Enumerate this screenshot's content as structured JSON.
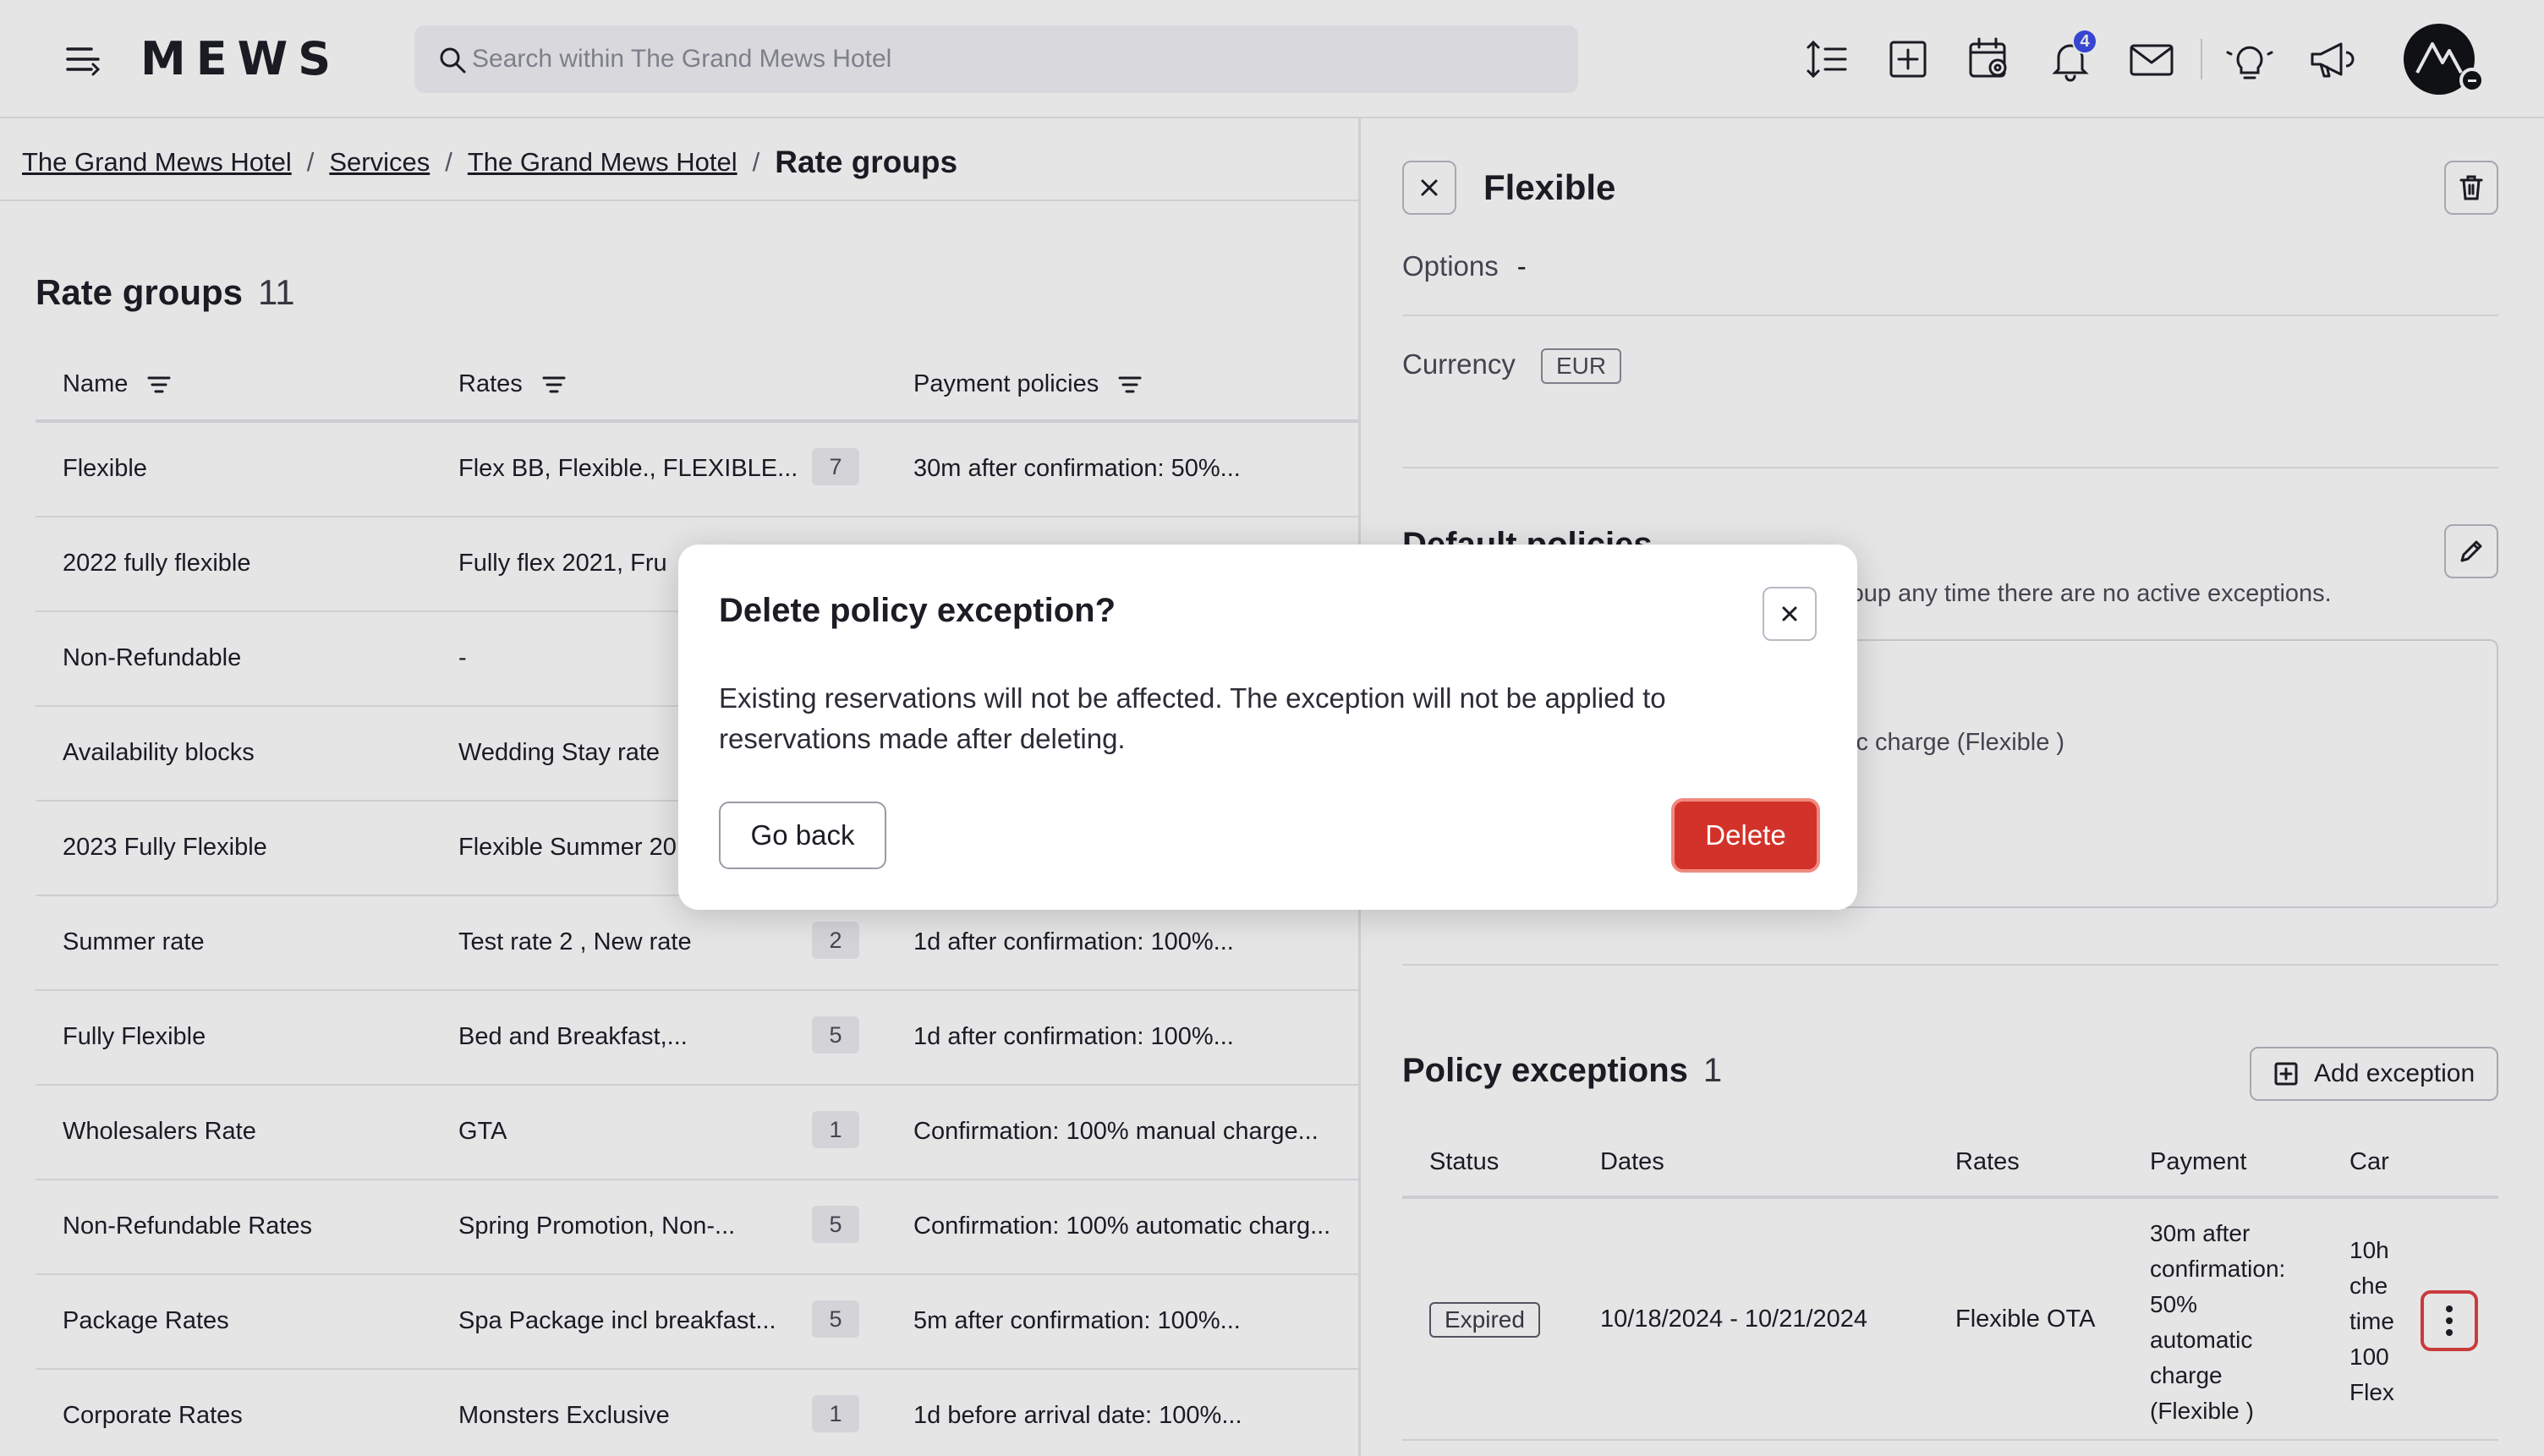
{
  "header": {
    "logo": "MEWS",
    "search_placeholder": "Search within The Grand Mews Hotel",
    "notification_count": "4",
    "icons": [
      "menu-icon",
      "sort-icon",
      "add-square-icon",
      "calendar-icon",
      "bell-icon",
      "mail-icon",
      "bulb-icon",
      "megaphone-icon",
      "avatar"
    ]
  },
  "breadcrumb": {
    "items": [
      "The Grand Mews Hotel",
      "Services",
      "The Grand Mews Hotel"
    ],
    "current": "Rate groups",
    "separator": "/"
  },
  "rate_groups": {
    "title": "Rate groups",
    "count": "11",
    "columns": [
      "Name",
      "Rates",
      "Payment policies"
    ],
    "rows": [
      {
        "name": "Flexible",
        "rates": "Flex BB, Flexible., FLEXIBLE...",
        "count": "7",
        "payment": "30m after confirmation: 50%..."
      },
      {
        "name": "2022 fully flexible",
        "rates": "Fully flex 2021, Fru",
        "count": "",
        "payment": ""
      },
      {
        "name": "Non-Refundable",
        "rates": "-",
        "count": "",
        "payment": ""
      },
      {
        "name": "Availability blocks",
        "rates": "Wedding Stay rate",
        "count": "",
        "payment": ""
      },
      {
        "name": "2023 Fully Flexible",
        "rates": "Flexible Summer 20",
        "count": "",
        "payment": ""
      },
      {
        "name": "Summer rate",
        "rates": "Test rate 2 , New rate",
        "count": "2",
        "payment": "1d after confirmation: 100%..."
      },
      {
        "name": "Fully Flexible",
        "rates": "Bed and Breakfast,...",
        "count": "5",
        "payment": "1d after confirmation: 100%..."
      },
      {
        "name": "Wholesalers Rate",
        "rates": "GTA",
        "count": "1",
        "payment": "Confirmation: 100% manual charge..."
      },
      {
        "name": "Non-Refundable Rates",
        "rates": "Spring Promotion, Non-...",
        "count": "5",
        "payment": "Confirmation: 100% automatic charg..."
      },
      {
        "name": "Package Rates",
        "rates": "Spa Package incl breakfast...",
        "count": "5",
        "payment": "5m after confirmation: 100%..."
      },
      {
        "name": "Corporate Rates",
        "rates": "Monsters Exclusive",
        "count": "1",
        "payment": "1d before arrival date: 100%..."
      }
    ]
  },
  "detail": {
    "title": "Flexible",
    "options_label": "Options",
    "options_value": "-",
    "currency_label": "Currency",
    "currency_value": "EUR",
    "default_policies_title": "Default policies",
    "default_policies_desc": "roup any time there are no active exceptions.",
    "default_policy_text": "tic charge (Flexible )",
    "exceptions_title": "Policy exceptions",
    "exceptions_count": "1",
    "add_exception_label": "Add exception",
    "exception_columns": [
      "Status",
      "Dates",
      "Rates",
      "Payment",
      "Car"
    ],
    "exception": {
      "status": "Expired",
      "dates": "10/18/2024 - 10/21/2024",
      "rates": "Flexible OTA",
      "payment_lines": [
        "30m after",
        "confirmation:",
        "50%",
        "automatic",
        "charge",
        "(Flexible )"
      ],
      "cancel_lines": [
        "10h",
        "che",
        "time",
        "100",
        "Flex"
      ]
    }
  },
  "modal": {
    "title": "Delete policy exception?",
    "body": "Existing reservations will not be affected. The exception will not be applied to reservations made after deleting.",
    "back_label": "Go back",
    "delete_label": "Delete"
  },
  "colors": {
    "accent": "#3d4ce8",
    "danger": "#d3322a",
    "highlight_border": "#e04040"
  }
}
